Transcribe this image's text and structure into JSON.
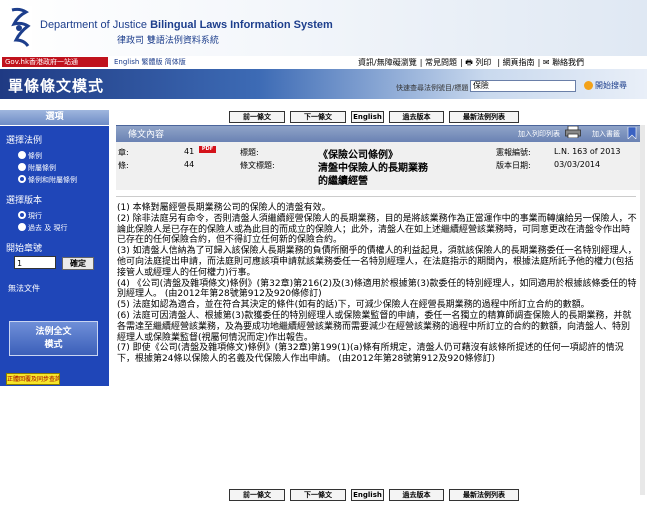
{
  "header": {
    "title_en_prefix": "Department of Justice",
    "title_en_bold": "Bilingual Laws Information System",
    "title_zh": "律政司 雙語法例資料系統"
  },
  "topnav": {
    "portal": "Gov.hk香港政府一站通",
    "english": "English 繁體版 简体版",
    "links": [
      "資訊/無障礙瀏覽",
      "常見問題",
      "列印",
      "網頁指南",
      "聯絡我們"
    ]
  },
  "banner": {
    "title": "單條條文模式",
    "search_label": "快速查尋法例號目/標題",
    "search_value": "保險",
    "search_go": "開始搜尋"
  },
  "sidebar": {
    "options_title": "選項",
    "law_section_title": "選擇法例",
    "law_options": [
      "條例",
      "附屬條例",
      "條例和附屬條例"
    ],
    "version_title": "選擇版本",
    "version_options": [
      "現行",
      "過去 及 現行"
    ],
    "start_no_label": "開始章號",
    "start_no_value": "1",
    "confirm": "確定",
    "no_docs": "無法文件",
    "fulltext_button": "法例全文\n模式",
    "yellow_button": "正體回覆及同步查詢"
  },
  "navigation": {
    "prev": "前一條文",
    "next": "下一條文",
    "english": "English",
    "past": "過去版本",
    "new_list": "最新法例列表"
  },
  "content": {
    "header_title": "條文內容",
    "print_link": "加入列印列表",
    "bookmark_link": "加入書籤",
    "pdf_badge": "PDF",
    "meta": {
      "chapter_label": "章:",
      "chapter_value": "41",
      "section_label": "條:",
      "section_value": "44",
      "title_label": "標題:",
      "title_value": "《保險公司條例》",
      "section_title_label": "條文標題:",
      "section_title_value": "清盤中保險人的長期業務",
      "section_title_value2": "的繼續經營",
      "gazette_label": "憲報編號:",
      "gazette_value": "L.N. 163 of 2013",
      "version_label": "版本日期:",
      "version_value": "03/03/2014"
    },
    "paragraphs": [
      "(1) 本條對屬經營長期業務公司的保險人的清盤有效。",
      "(2) 除非法庭另有命令，否則清盤人須繼續經營保險人的長期業務，目的是將該業務作為正當運作中的事業而轉讓給另一保險人，不論此保險人是已存在的保險人或為此目的而成立的保險人；此外，清盤人在如上述繼續經營該業務時，可同意更改在清盤令作出時已存在的任何保險合約，但不得訂立任何新的保險合約。",
      "(3) 如清盤人信納為了可歸入該保險人長期業務的負債所關乎的債權人的利益起見，須就該保險人的長期業務委任一名特別經理人，他可向法庭提出申請，而法庭則可應該項申請就該業務委任一名特別經理人，在法庭指示的期間內，根據法庭所託予他的權力(包括接管人或經理人的任何權力)行事。",
      "(4) 《公司(清盤及雜項條文)條例》(第32章)第216(2)及(3)條適用於根據第(3)款委任的特別經理人，如同適用於根據該條委任的特別經理人。 (由2012年第28號第912及920條修訂)",
      "(5) 法庭如認為適合，並在符合其決定的條件(如有的話)下，可減少保險人在經營長期業務的過程中所訂立合約的數額。",
      "(6) 法庭可因清盤人、根據第(3)款獲委任的特別經理人或保險業監督的申請，委任一名獨立的精算師調查保險人的長期業務，并就各需達至繼續經營該業務，及為要成功地繼續經營該業務而需要減少在經營該業務的過程中所訂立的合約的數額，向清盤人、特別經理人或保險業監督(視屬何情況而定)作出報告。",
      "(7) 即使《公司(清盤及雜項條文)條例》(第32章)第199(1)(a)條有所規定，清盤人仍可藉沒有該條所提述的任何一項認許的情況下，根據第24條以保險人的名義及代保險人作出申請。 (由2012年第28號第912及920條修訂)"
    ]
  },
  "colors": {
    "sidebar_blue": "#1f46b8",
    "banner_blue": "#1f3a83",
    "portal_red": "#c0121d",
    "yellow": "#f6e62a"
  }
}
